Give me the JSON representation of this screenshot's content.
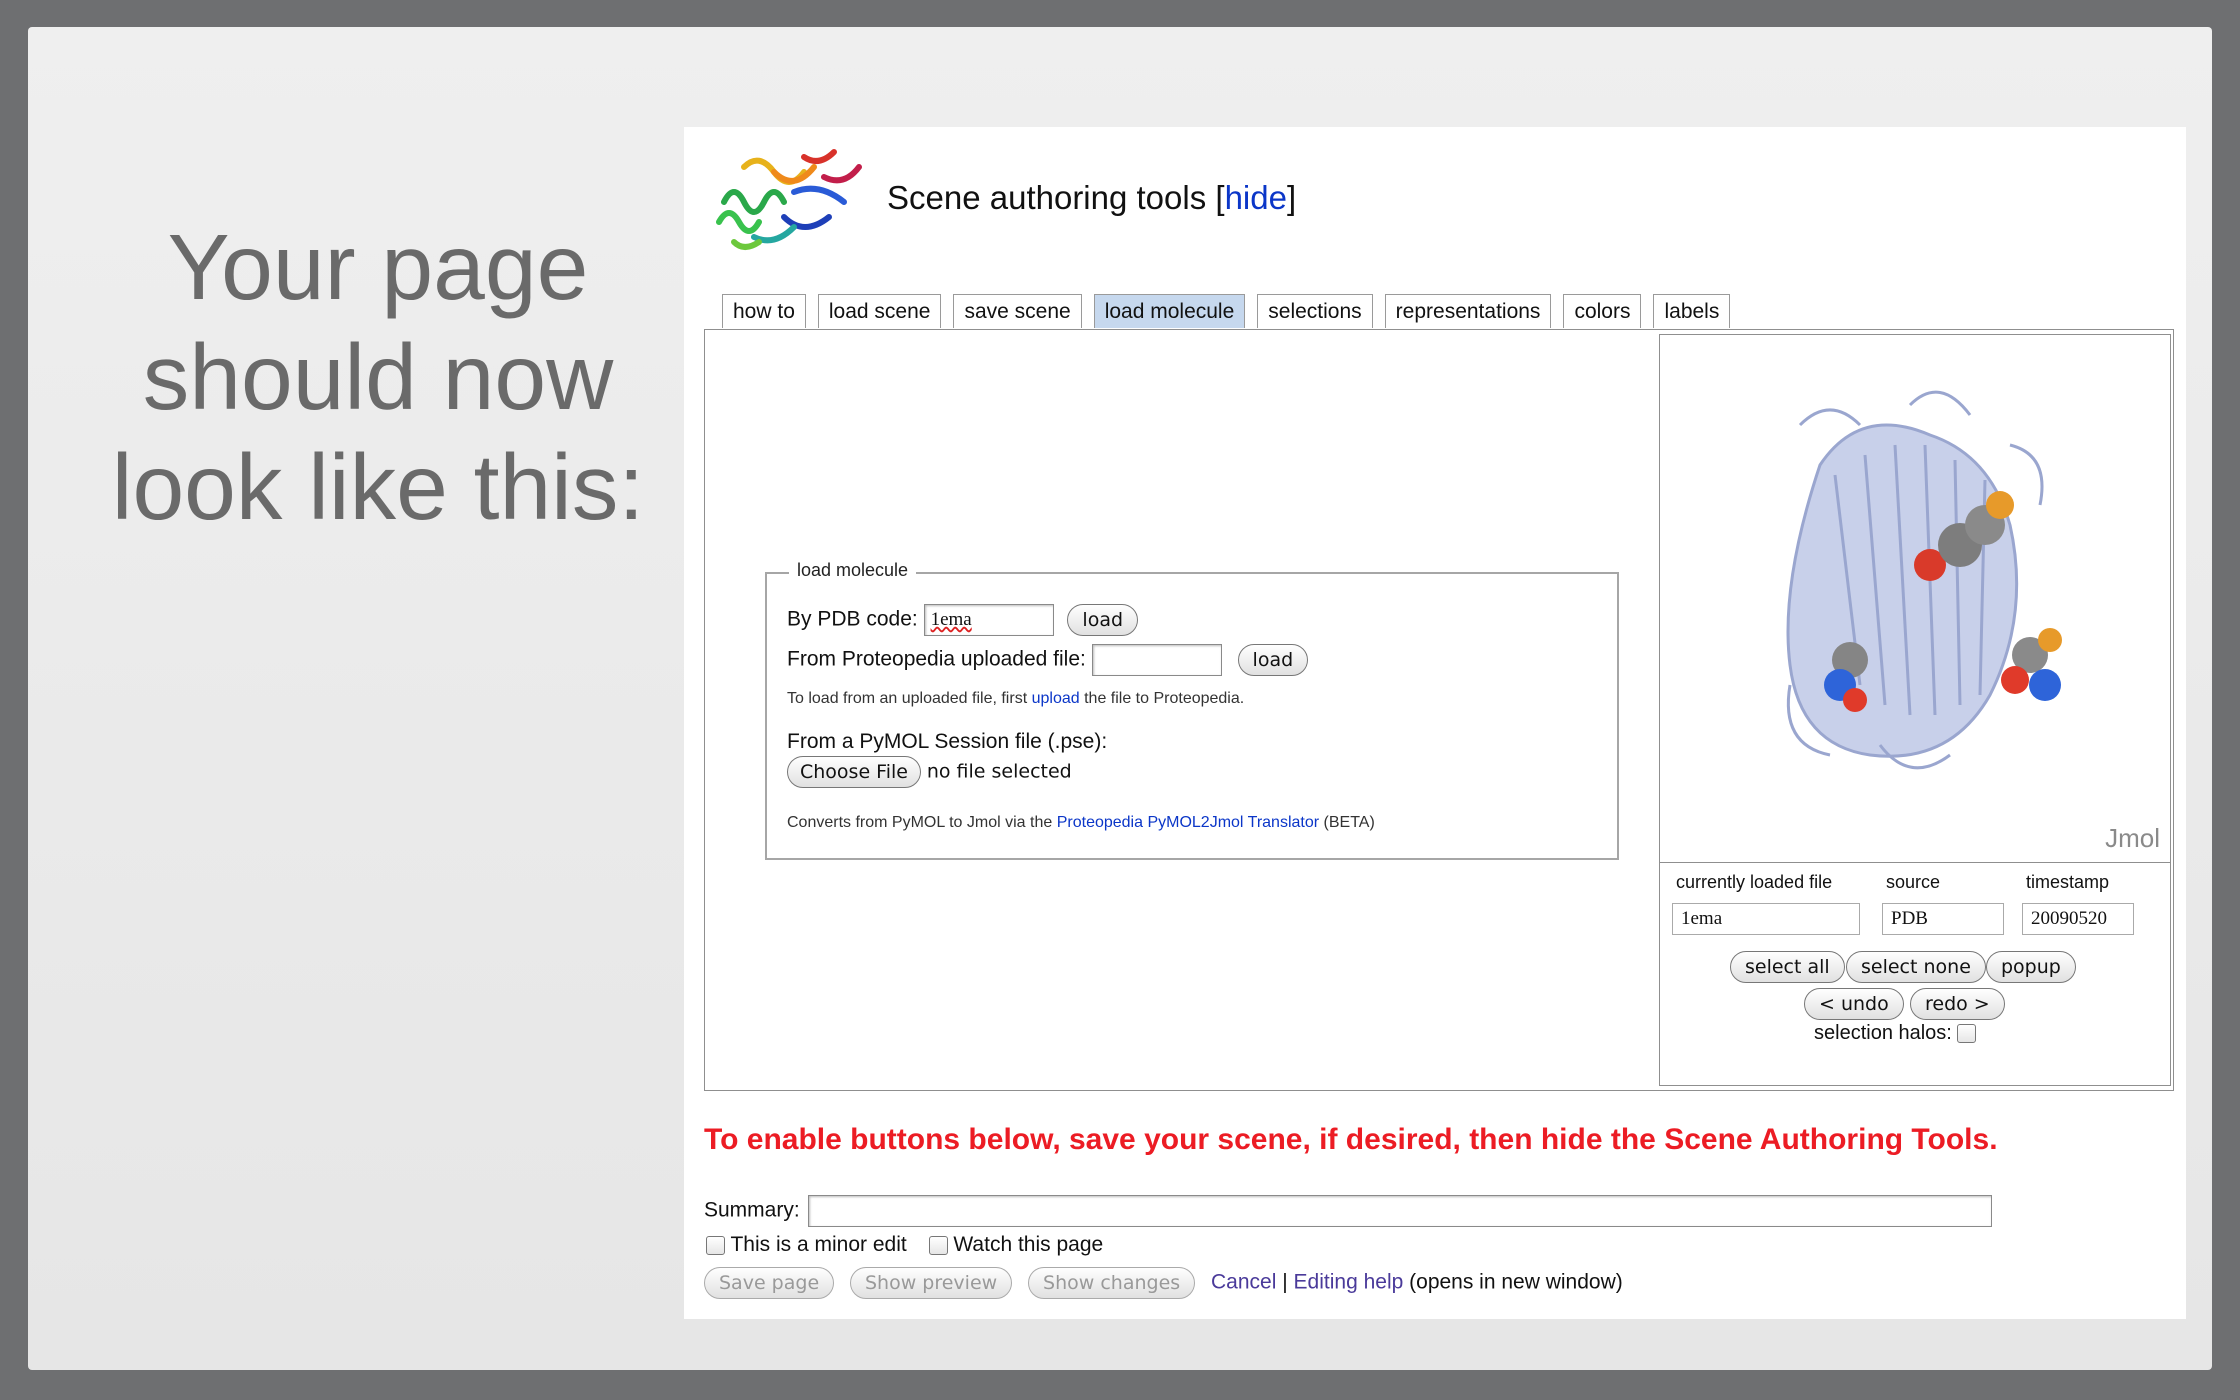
{
  "slide": {
    "title_lines": [
      "Your page",
      "should now",
      "look like this:"
    ]
  },
  "header": {
    "title": "Scene authoring tools [",
    "hide_link": "hide",
    "title_close": "]"
  },
  "tabs": [
    "how to",
    "load scene",
    "save scene",
    "load molecule",
    "selections",
    "representations",
    "colors",
    "labels"
  ],
  "active_tab": "load molecule",
  "load_molecule": {
    "legend": "load molecule",
    "pdb_label": "By PDB code:",
    "pdb_value": "1ema",
    "load_label": "load",
    "upload_label": "From Proteopedia uploaded file:",
    "upload_value": "",
    "upload_hint_pre": "To load from an uploaded file, first",
    "upload_hint_link": "upload",
    "upload_hint_post": "the file to Proteopedia.",
    "pymol_label": "From a PyMOL Session file (.pse):",
    "choose_file": "Choose File",
    "no_file": "no file selected",
    "convert_pre": "Converts from PyMOL to Jmol via the",
    "convert_link": "Proteopedia PyMOL2Jmol Translator",
    "convert_post": "(BETA)"
  },
  "viewer": {
    "logo": "Jmol",
    "file_label": "currently loaded file",
    "file_value": "1ema",
    "source_label": "source",
    "source_value": "PDB",
    "timestamp_label": "timestamp",
    "timestamp_value": "20090520",
    "select_all": "select all",
    "select_none": "select none",
    "popup": "popup",
    "undo": "< undo",
    "redo": "redo >",
    "halos_label": "selection halos:",
    "halos_checked": false
  },
  "warning": "To enable buttons below, save your scene, if desired, then hide the Scene Authoring Tools.",
  "edit": {
    "summary_label": "Summary:",
    "summary_value": "",
    "minor_edit": "This is a minor edit",
    "watch": "Watch this page",
    "save_page": "Save page",
    "show_preview": "Show preview",
    "show_changes": "Show changes",
    "cancel": "Cancel",
    "separator": "|",
    "editing_help": "Editing help",
    "opens_new": "(opens in new window)"
  },
  "colors": {
    "warning": "#ec1c24",
    "link": "#0b36c8",
    "active_tab": "#c6d8ee"
  }
}
